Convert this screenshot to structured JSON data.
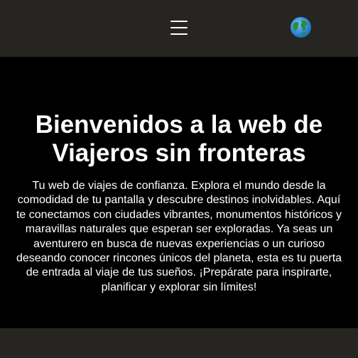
{
  "header": {
    "menu_icon": "hamburger-menu-icon",
    "globe_icon": "globe-icon"
  },
  "hero": {
    "title": "Bienvenidos a la web de Viajeros sin fronteras",
    "description": "Tu web de viajes de confianza. Explora el mundo desde la comodidad de tu pantalla y descubre destinos inolvidables. Aquí te conectamos con ciudades vibrantes, monumentos históricos y maravillas naturales que esperan ser exploradas. Ya seas un aventurero en busca de nuevas experiencias o un curioso deseando conocer rincones únicos del planeta, esta es tu puerta de entrada al viaje de tus sueños. ¡Prepárate para inspirarte, planificar y explorar sin límites!"
  },
  "colors": {
    "header_bg": "#262522",
    "page_bg": "#000000",
    "text": "#ffffff"
  }
}
